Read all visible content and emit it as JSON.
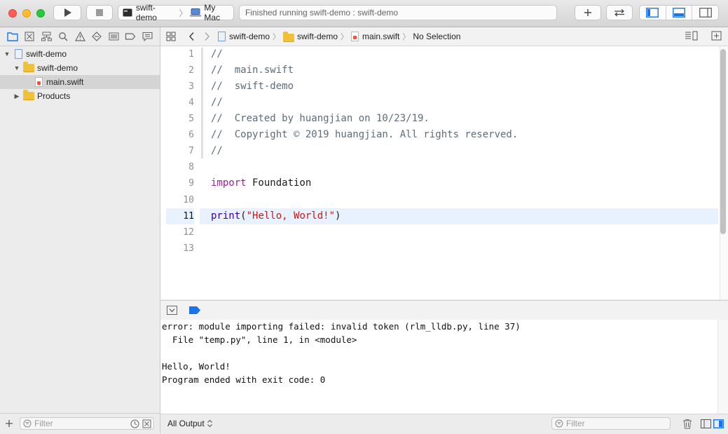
{
  "toolbar": {
    "scheme_target": "swift-demo",
    "scheme_device": "My Mac",
    "status_text": "Finished running swift-demo : swift-demo"
  },
  "navigator": {
    "items": [
      {
        "label": "swift-demo"
      },
      {
        "label": "swift-demo"
      },
      {
        "label": "main.swift"
      },
      {
        "label": "Products"
      }
    ],
    "filter_placeholder": "Filter"
  },
  "jumpbar": {
    "crumbs": [
      "swift-demo",
      "swift-demo",
      "main.swift",
      "No Selection"
    ]
  },
  "editor": {
    "line_numbers": [
      "1",
      "2",
      "3",
      "4",
      "5",
      "6",
      "7",
      "8",
      "9",
      "10",
      "11",
      "12",
      "13"
    ],
    "current_line": "11",
    "lines": {
      "l1": "//",
      "l2": "//  main.swift",
      "l3": "//  swift-demo",
      "l4": "//",
      "l5": "//  Created by huangjian on 10/23/19.",
      "l6": "//  Copyright © 2019 huangjian. All rights reserved.",
      "l7": "//",
      "l9_kw": "import",
      "l9_rest": " Foundation",
      "l11_fn": "print",
      "l11_open": "(",
      "l11_str": "\"Hello, World!\"",
      "l11_close": ")"
    }
  },
  "console": {
    "lines": [
      "error: module importing failed: invalid token (rlm_lldb.py, line 37)",
      "  File \"temp.py\", line 1, in <module>",
      "",
      "Hello, World!",
      "Program ended with exit code: 0"
    ],
    "output_selector": "All Output",
    "filter_placeholder": "Filter"
  },
  "colors": {
    "accent": "#1a73e8",
    "comment": "#5d6c79",
    "keyword": "#9b2393",
    "function": "#3900a0",
    "string": "#c41a16"
  }
}
